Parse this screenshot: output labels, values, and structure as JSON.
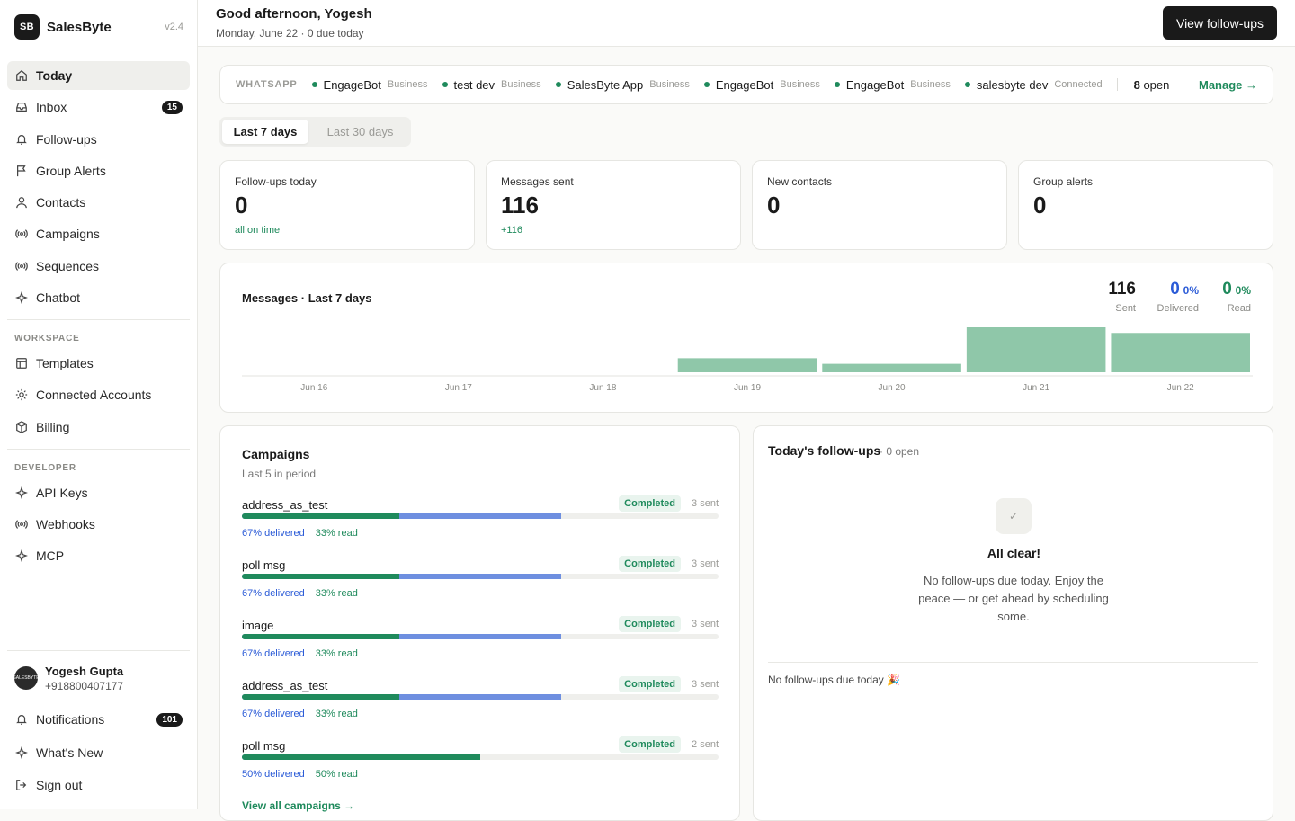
{
  "brand": {
    "logo": "SB",
    "name": "SalesByte",
    "version": "v2.4"
  },
  "sidebar": {
    "main": [
      {
        "label": "Today",
        "icon": "home-icon",
        "active": true
      },
      {
        "label": "Inbox",
        "icon": "inbox-icon",
        "badge": "15"
      },
      {
        "label": "Follow-ups",
        "icon": "bell-icon"
      },
      {
        "label": "Group Alerts",
        "icon": "flag-icon"
      },
      {
        "label": "Contacts",
        "icon": "user-icon"
      },
      {
        "label": "Campaigns",
        "icon": "broadcast-icon"
      },
      {
        "label": "Sequences",
        "icon": "broadcast-icon"
      },
      {
        "label": "Chatbot",
        "icon": "sparkle-icon"
      }
    ],
    "workspace_title": "WORKSPACE",
    "workspace": [
      {
        "label": "Templates",
        "icon": "template-icon"
      },
      {
        "label": "Connected Accounts",
        "icon": "sun-icon"
      },
      {
        "label": "Billing",
        "icon": "box-icon"
      }
    ],
    "developer_title": "DEVELOPER",
    "developer": [
      {
        "label": "API Keys",
        "icon": "sparkle-icon"
      },
      {
        "label": "Webhooks",
        "icon": "broadcast-icon"
      },
      {
        "label": "MCP",
        "icon": "sparkle-icon"
      }
    ],
    "user": {
      "name": "Yogesh Gupta",
      "phone": "+918800407177",
      "avatar_text": "SALESBYTE"
    },
    "footer": [
      {
        "label": "Notifications",
        "icon": "bell-icon",
        "badge": "101"
      },
      {
        "label": "What's New",
        "icon": "sparkle-icon"
      },
      {
        "label": "Sign out",
        "icon": "sign-out-icon"
      }
    ]
  },
  "header": {
    "greeting": "Good afternoon, Yogesh",
    "subtitle": "Monday, June 22 · 0 due today",
    "button": "View follow-ups"
  },
  "whatsapp": {
    "label": "WHATSAPP",
    "accounts": [
      {
        "name": "EngageBot",
        "type": "Business"
      },
      {
        "name": "test dev",
        "type": "Business"
      },
      {
        "name": "SalesByte App",
        "type": "Business"
      },
      {
        "name": "EngageBot",
        "type": "Business"
      },
      {
        "name": "EngageBot",
        "type": "Business"
      },
      {
        "name": "salesbyte dev",
        "type": "Connected"
      }
    ],
    "open_count": "8",
    "open_label": "open",
    "manage": "Manage →"
  },
  "range_tabs": [
    {
      "label": "Last 7 days",
      "active": true
    },
    {
      "label": "Last 30 days",
      "active": false
    }
  ],
  "stats": [
    {
      "label": "Follow-ups today",
      "value": "0",
      "sub": "all on time"
    },
    {
      "label": "Messages sent",
      "value": "116",
      "sub": "+116"
    },
    {
      "label": "New contacts",
      "value": "0",
      "sub": ""
    },
    {
      "label": "Group alerts",
      "value": "0",
      "sub": ""
    }
  ],
  "messages_chart": {
    "title": "Messages · Last 7 days",
    "metrics": [
      {
        "value": "116",
        "pct": "",
        "label": "Sent",
        "color": "#1a1a1a"
      },
      {
        "value": "0",
        "pct": "0%",
        "label": "Delivered",
        "color": "#2b5bd7"
      },
      {
        "value": "0",
        "pct": "0%",
        "label": "Read",
        "color": "#1f8a5c"
      }
    ]
  },
  "chart_data": {
    "type": "bar",
    "title": "Messages · Last 7 days",
    "categories": [
      "Jun 16",
      "Jun 17",
      "Jun 18",
      "Jun 19",
      "Jun 20",
      "Jun 21",
      "Jun 22"
    ],
    "values": [
      0,
      0,
      0,
      15,
      9,
      48,
      42
    ],
    "bar_color": "#8fc7a9",
    "grid": false
  },
  "campaigns": {
    "title": "Campaigns",
    "subtitle": "Last 5 in period",
    "items": [
      {
        "name": "address_as_test",
        "status": "Completed",
        "sent": "3 sent",
        "delivered_pct": 67,
        "read_pct": 33,
        "delivered_text": "67% delivered",
        "read_text": "33% read"
      },
      {
        "name": "poll msg",
        "status": "Completed",
        "sent": "3 sent",
        "delivered_pct": 67,
        "read_pct": 33,
        "delivered_text": "67% delivered",
        "read_text": "33% read"
      },
      {
        "name": "image",
        "status": "Completed",
        "sent": "3 sent",
        "delivered_pct": 67,
        "read_pct": 33,
        "delivered_text": "67% delivered",
        "read_text": "33% read"
      },
      {
        "name": "address_as_test",
        "status": "Completed",
        "sent": "3 sent",
        "delivered_pct": 67,
        "read_pct": 33,
        "delivered_text": "67% delivered",
        "read_text": "33% read"
      },
      {
        "name": "poll msg",
        "status": "Completed",
        "sent": "2 sent",
        "delivered_pct": 50,
        "read_pct": 50,
        "delivered_text": "50% delivered",
        "read_text": "50% read"
      }
    ],
    "view_all": "View all campaigns →"
  },
  "followups": {
    "title": "Today's follow-ups",
    "open": "· 0 open",
    "check": "✓",
    "clear_title": "All clear!",
    "message": "No follow-ups due today. Enjoy the peace — or get ahead by scheduling some.",
    "footer": "No follow-ups due today 🎉"
  }
}
